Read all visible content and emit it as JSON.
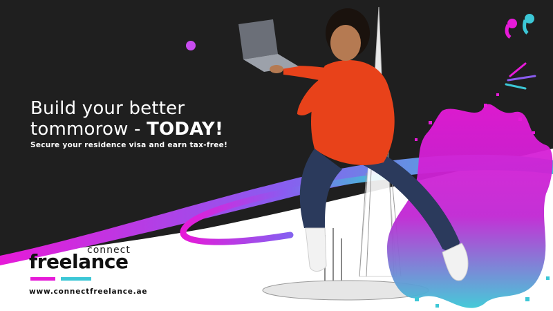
{
  "headline": {
    "line1": "Build your better",
    "line2_prefix": "tommorow - ",
    "line2_emphasis": "TODAY!"
  },
  "subheadline": "Secure your residence visa and earn tax-free!",
  "logo": {
    "small_word": "connect",
    "big_word": "freelance"
  },
  "website": "www.connectfreelance.ae",
  "colors": {
    "background_dark": "#1f1f1f",
    "accent_pink": "#e61ad8",
    "accent_cyan": "#3cc7d6",
    "accent_purple": "#8a5cf0",
    "sweater": "#e8421a",
    "jeans": "#2b3a5c"
  },
  "decor": [
    "quote-mark-icon",
    "sparkle-lines-icon",
    "burj-khalifa-sketch",
    "paint-splash",
    "person-with-laptop"
  ]
}
